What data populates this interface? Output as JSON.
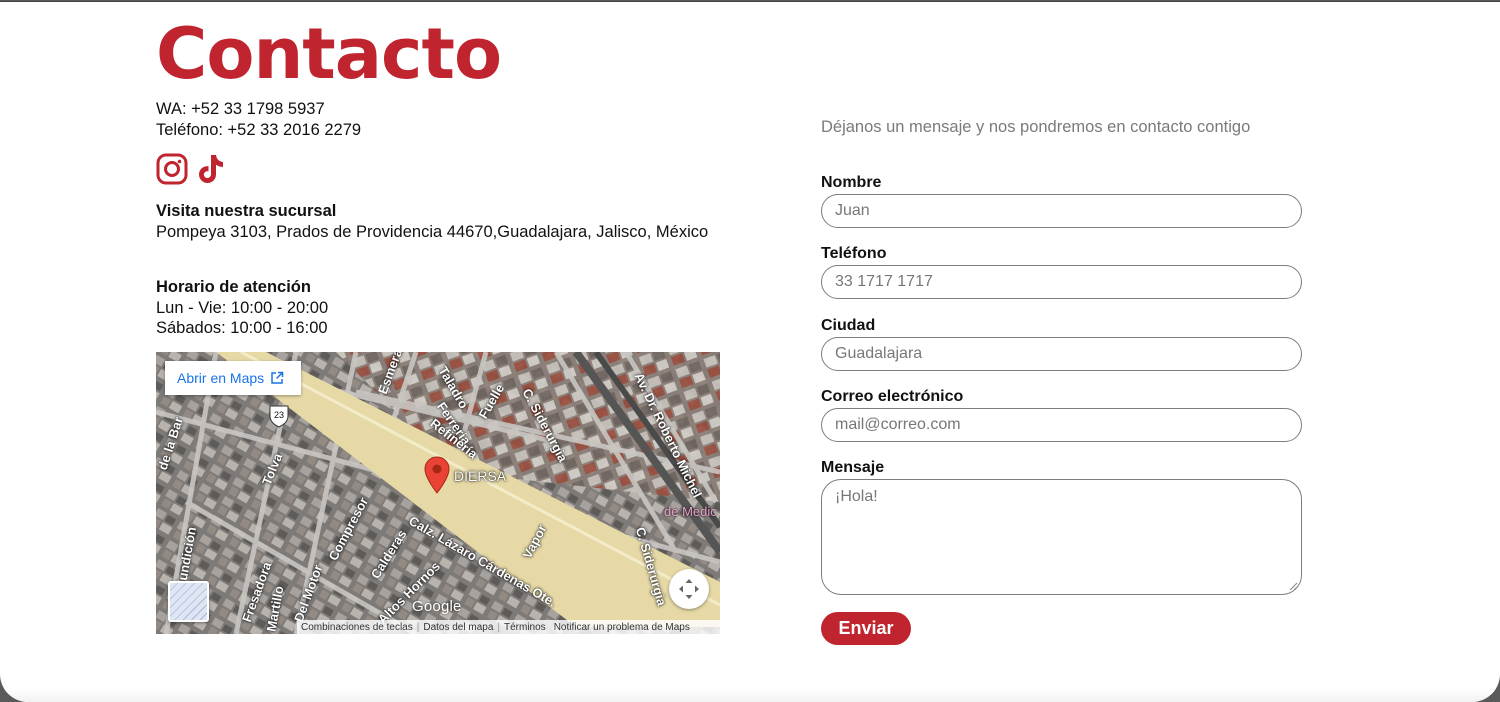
{
  "header": {
    "title": "Contacto"
  },
  "contact": {
    "whatsapp": "WA: +52 33 1798 5937",
    "phone": "Teléfono: +52 33 2016 2279"
  },
  "social": {
    "icons": [
      "instagram-icon",
      "tiktok-icon"
    ]
  },
  "branch": {
    "heading": "Visita nuestra sucursal",
    "address": "Pompeya 3103, Prados de Providencia 44670,Guadalajara, Jalisco, México"
  },
  "hours": {
    "heading": "Horario de atención",
    "weekdays": "Lun - Vie: 10:00 - 20:00",
    "saturday": "Sábados: 10:00 - 16:00"
  },
  "map": {
    "open_link": "Abrir en Maps",
    "marker_label": "DIERSA",
    "poi_label": "de Medic",
    "highway_shield": "23",
    "logo": "Google",
    "footer": [
      "Combinaciones de teclas",
      "Datos del mapa",
      "Términos",
      "Notificar un problema de Maps"
    ],
    "streets": [
      "Esmeralda",
      "Taladro",
      "Fuelle",
      "C. Siderurgia",
      "Av. Dr. Roberto Michel",
      "Ferrería",
      "Refinería",
      "Tolva",
      "Calz. Lázaro Cárdenas Ote.",
      "Calderas",
      "Compresor",
      "Vapor",
      "C. Siderurgia",
      "C. Fundición",
      "Fresadora",
      "Martillo",
      "Del Motor",
      "Altos Hornos",
      "de la Bar"
    ]
  },
  "form": {
    "intro": "Déjanos un mensaje y nos pondremos en contacto contigo",
    "name_label": "Nombre",
    "name_placeholder": "Juan",
    "phone_label": "Teléfono",
    "phone_placeholder": "33 1717 1717",
    "city_label": "Ciudad",
    "city_placeholder": "Guadalajara",
    "email_label": "Correo electrónico",
    "email_placeholder": "mail@correo.com",
    "message_label": "Mensaje",
    "message_placeholder": "¡Hola!",
    "submit_label": "Enviar"
  },
  "colors": {
    "brand": "#c0242e",
    "link": "#1a73e8"
  }
}
